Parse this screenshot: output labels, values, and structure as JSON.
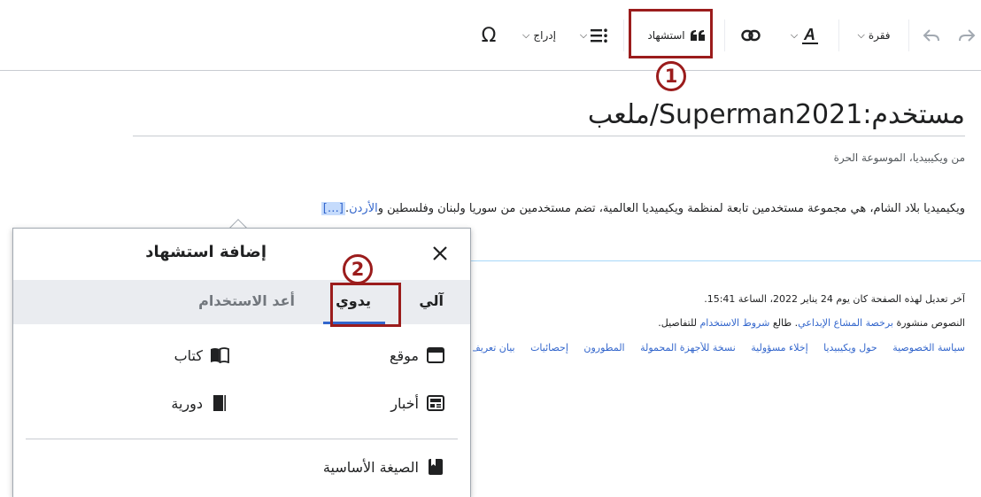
{
  "toolbar": {
    "paragraph_label": "فقرة",
    "citation_label": "استشهاد",
    "insert_label": "إدراج"
  },
  "annotations": {
    "step1": "1",
    "step2": "2"
  },
  "page": {
    "title": "مستخدم:Superman2021/ملعب",
    "tagline": "من ويكيبيديا، الموسوعة الحرة",
    "body_text": "ويكيميديا بلاد الشام، هي مجموعة مستخدمين تابعة لمنظمة ويكيميديا العالمية، تضم مستخدمين من سوريا ولبنان وفلسطين و",
    "body_link": "الأردن",
    "ref_marker": "[…]"
  },
  "footer": {
    "last_edit": "آخر تعديل لهذه الصفحة كان يوم 24 يناير 2022، الساعة 15:41.",
    "license_prefix": "النصوص منشورة ",
    "license_link": "برخصة المشاع الإبداعي",
    "license_mid": ". طالع ",
    "terms_link": "شروط الاستخدام",
    "license_suffix": " للتفاصيل.",
    "links": [
      "سياسة الخصوصية",
      "حول ويكيبيديا",
      "إخلاء مسؤولية",
      "نسخة للأجهزة المحمولة",
      "المطورون",
      "إحصائيات",
      "بيان تعريف الكعكات"
    ]
  },
  "popup": {
    "title": "إضافة استشهاد",
    "tabs": {
      "auto": "آلي",
      "manual": "يدوي",
      "reuse": "أعد الاستخدام"
    },
    "options": {
      "website": "موقع",
      "book": "كتاب",
      "news": "أخبار",
      "journal": "دورية",
      "basic": "الصيغة الأساسية"
    }
  },
  "colors": {
    "annotation": "#9b1c1c",
    "link": "#3366cc",
    "tab_bg": "#eaecf0"
  }
}
